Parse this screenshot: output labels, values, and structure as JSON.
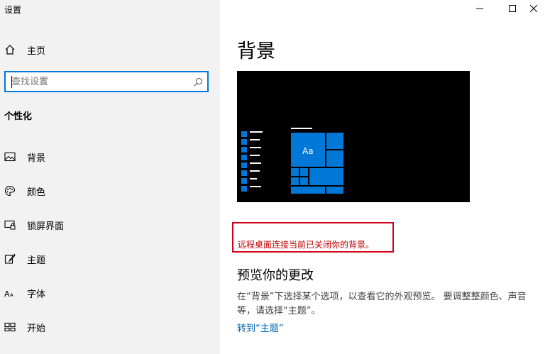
{
  "window": {
    "title": "设置",
    "controls": [
      "minimize",
      "maximize",
      "close"
    ]
  },
  "sidebar": {
    "home_label": "主页",
    "search_placeholder": "查找设置",
    "section_heading": "个性化",
    "items": [
      {
        "label": "背景",
        "icon": "image-icon"
      },
      {
        "label": "颜色",
        "icon": "palette-icon"
      },
      {
        "label": "锁屏界面",
        "icon": "lock-screen-icon"
      },
      {
        "label": "主题",
        "icon": "theme-brush-icon"
      },
      {
        "label": "字体",
        "icon": "font-icon"
      },
      {
        "label": "开始",
        "icon": "start-tiles-icon"
      }
    ]
  },
  "main": {
    "page_title": "背景",
    "preview_tile_text": "Aa",
    "warning": "远程桌面连接当前已关闭你的背景。",
    "preview_heading": "预览你的更改",
    "description": "在“背景”下选择某个选项，以查看它的外观预览。 要调整整颜色、声音等，请选择“主题”。",
    "link": "转到“主题”"
  },
  "colors": {
    "accent": "#0078d7",
    "sidebar_bg": "#f2f2f2",
    "warning": "#c00000",
    "link": "#0063b1"
  }
}
